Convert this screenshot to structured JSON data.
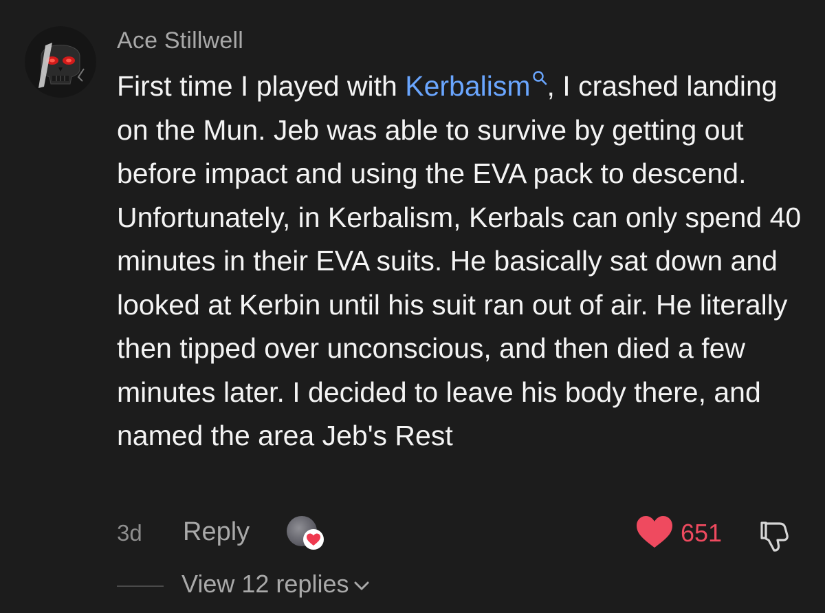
{
  "comment": {
    "author": "Ace Stillwell",
    "text_before_link": "First time I played with ",
    "link_text": "Kerbalism",
    "text_after_link": ", I crashed landing on the Mun. Jeb was able to survive by getting out before impact and using the EVA pack to descend. Unfortunately, in Kerbalism, Kerbals can only spend 40 minutes in their EVA suits. He basically sat down and looked at Kerbin until his suit ran out of air. He literally then tipped over unconscious, and then died a few minutes later. I decided to leave his body there, and named the area Jeb's Rest",
    "age": "3d",
    "reply_label": "Reply",
    "like_count": "651",
    "view_replies_label": "View 12 replies"
  },
  "colors": {
    "background": "#1c1c1c",
    "link": "#6aa6ff",
    "like": "#ef4a5f",
    "muted": "#a9a9a9"
  },
  "icons": {
    "avatar": "skull-avatar",
    "search": "search-icon",
    "like": "heart-icon",
    "creator_like": "creator-heart-icon",
    "dislike": "thumbs-down-icon",
    "expand": "chevron-down-icon"
  }
}
